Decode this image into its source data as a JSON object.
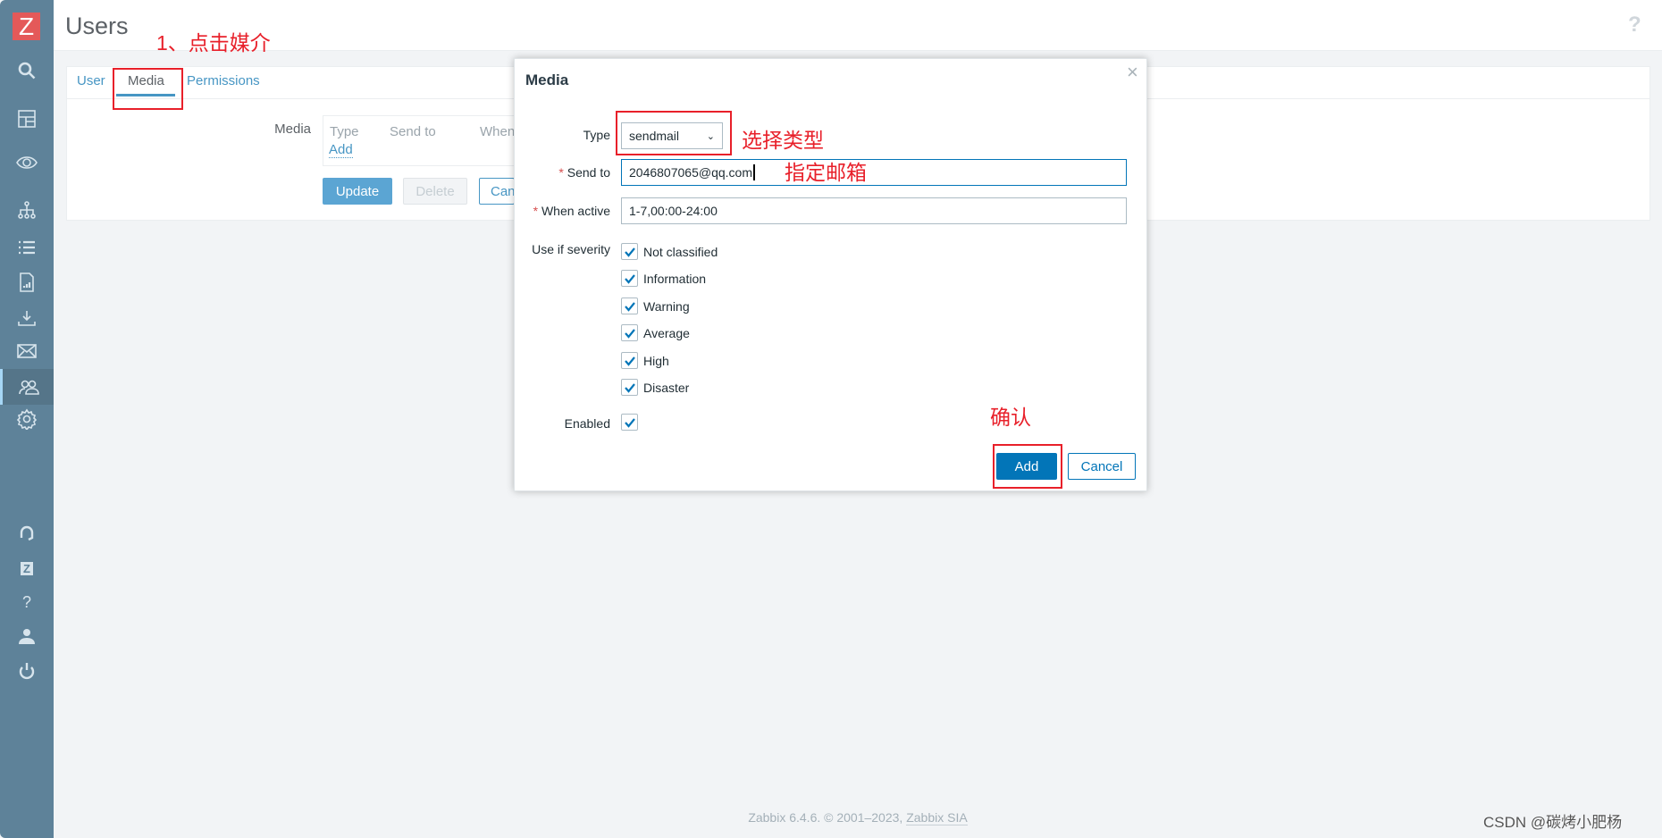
{
  "sidebar": {
    "logo": "Z",
    "items": [
      "search-icon",
      "dashboard-icon",
      "monitoring-eye-icon",
      "inventory-sitemap-icon",
      "list-icon",
      "reports-icon",
      "download-icon",
      "mail-icon",
      "users-icon",
      "gear-icon"
    ],
    "bottom": [
      "support-headset-icon",
      "integrations-z-icon",
      "help-icon",
      "user-profile-icon",
      "power-icon"
    ],
    "active": "users-icon"
  },
  "header": {
    "title": "Users",
    "help": "?"
  },
  "tabs": [
    {
      "label": "User"
    },
    {
      "label": "Media",
      "selected": true
    },
    {
      "label": "Permissions"
    }
  ],
  "media_section": {
    "label": "Media",
    "columns": [
      "Type",
      "Send to",
      "When"
    ],
    "add_link": "Add"
  },
  "buttons": {
    "update": "Update",
    "delete": "Delete",
    "cancel": "Can"
  },
  "dialog": {
    "title": "Media",
    "close": "×",
    "type_label": "Type",
    "type_value": "sendmail",
    "send_to_label": "Send to",
    "send_to_value": "2046807065@qq.com",
    "when_active_label": "When active",
    "when_active_value": "1-7,00:00-24:00",
    "severity_label": "Use if severity",
    "severities": [
      {
        "label": "Not classified",
        "checked": true
      },
      {
        "label": "Information",
        "checked": true
      },
      {
        "label": "Warning",
        "checked": true
      },
      {
        "label": "Average",
        "checked": true
      },
      {
        "label": "High",
        "checked": true
      },
      {
        "label": "Disaster",
        "checked": true
      }
    ],
    "enabled_label": "Enabled",
    "enabled": true,
    "add": "Add",
    "cancel": "Cancel"
  },
  "annotations": {
    "click_media": "1、点击媒介",
    "select_type": "选择类型",
    "set_mail": "指定邮箱",
    "confirm": "确认",
    "color": "#e8202a"
  },
  "footer": {
    "text": "Zabbix 6.4.6. © 2001–2023, ",
    "link": "Zabbix SIA"
  },
  "watermark": "CSDN @碳烤小肥杨",
  "colors": {
    "sidebar": "#5e8299",
    "accent": "#0275b8",
    "logo": "#e45959"
  }
}
